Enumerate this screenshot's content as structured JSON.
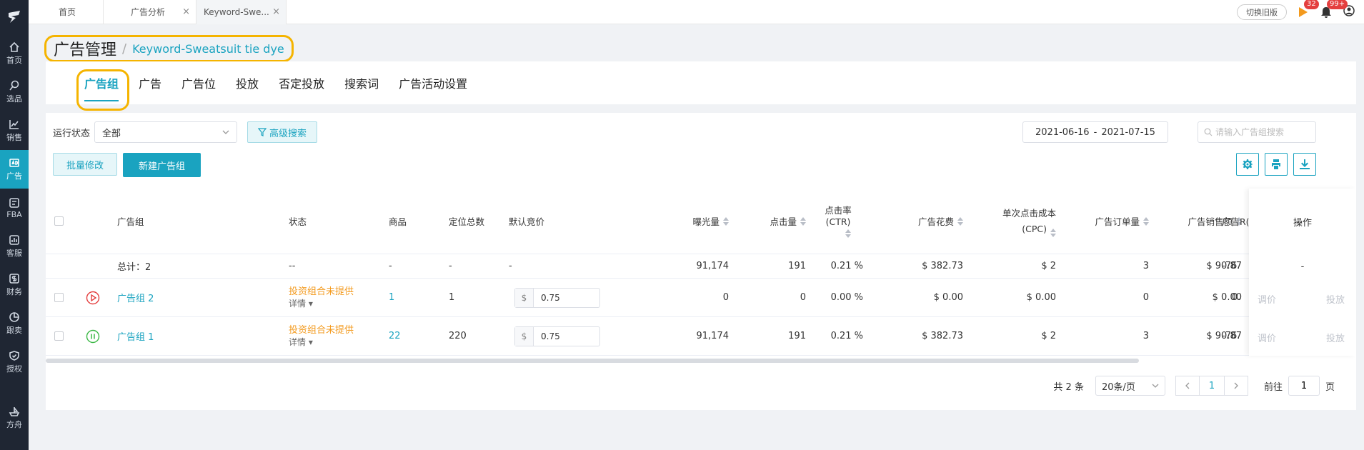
{
  "sidebar": {
    "items": [
      {
        "label": "首页",
        "icon": "home-icon"
      },
      {
        "label": "选品",
        "icon": "search-icon"
      },
      {
        "label": "销售",
        "icon": "chart-line-icon"
      },
      {
        "label": "广告",
        "icon": "ad-icon",
        "active": true
      },
      {
        "label": "FBA",
        "icon": "fba-icon"
      },
      {
        "label": "客服",
        "icon": "service-icon"
      },
      {
        "label": "财务",
        "icon": "finance-icon"
      },
      {
        "label": "跟卖",
        "icon": "pie-icon"
      },
      {
        "label": "授权",
        "icon": "shield-icon"
      }
    ],
    "bottom": {
      "label": "方舟",
      "icon": "ark-icon"
    }
  },
  "topbar": {
    "tabs": [
      "首页",
      "广告分析",
      "Keyword-Swe..."
    ],
    "switch_label": "切换旧版",
    "flag_badge": "32",
    "bell_badge": "99+"
  },
  "breadcrumb": {
    "main": "广告管理",
    "sep": "/",
    "sub": "Keyword-Sweatsuit tie dye"
  },
  "subtabs": [
    "广告组",
    "广告",
    "广告位",
    "投放",
    "否定投放",
    "搜索词",
    "广告活动设置"
  ],
  "filters": {
    "status_label": "运行状态",
    "status_value": "全部",
    "advanced_label": "高级搜索",
    "date_start": "2021-06-16",
    "date_sep": "-",
    "date_end": "2021-07-15",
    "search_placeholder": "请输入广告组搜索"
  },
  "buttons": {
    "batch_edit": "批量修改",
    "new_group": "新建广告组"
  },
  "table": {
    "headers": {
      "group": "广告组",
      "status": "状态",
      "product": "商品",
      "targets": "定位总数",
      "bid": "默认竞价",
      "impressions": "曝光量",
      "clicks": "点击量",
      "ctr_1": "点击率",
      "ctr_2": "(CTR)",
      "spend": "广告花费",
      "cpc_1": "单次点击成本",
      "cpc_2": "(CPC)",
      "orders": "广告订单量",
      "sales": "广告销售额",
      "acos": "广告R(",
      "ops": "操作"
    },
    "total": {
      "label": "总计：2",
      "status": "--",
      "product": "-",
      "targets": "-",
      "bid": "-",
      "impressions": "91,174",
      "clicks": "191",
      "ctr": "0.21 %",
      "spend": "$ 382.73",
      "cpc": "$ 2",
      "orders": "3",
      "sales": "$ 90.87",
      "acos": "-76.",
      "ops": "-"
    },
    "rows": [
      {
        "name": "广告组 2",
        "state_icon": "play-circle-icon",
        "status": "投资组合未提供",
        "detail": "详情",
        "product": "1",
        "targets": "1",
        "currency": "$",
        "bid": "0.75",
        "impressions": "0",
        "clicks": "0",
        "ctr": "0.00 %",
        "spend": "$ 0.00",
        "cpc": "$ 0.00",
        "orders": "0",
        "sales": "$ 0.00",
        "acos": "0.",
        "op1": "调价",
        "op2": "投放"
      },
      {
        "name": "广告组 1",
        "state_icon": "pause-circle-icon",
        "status": "投资组合未提供",
        "detail": "详情",
        "product": "22",
        "targets": "220",
        "currency": "$",
        "bid": "0.75",
        "impressions": "91,174",
        "clicks": "191",
        "ctr": "0.21 %",
        "spend": "$ 382.73",
        "cpc": "$ 2",
        "orders": "3",
        "sales": "$ 90.87",
        "acos": "-76.",
        "op1": "调价",
        "op2": "投放"
      }
    ]
  },
  "pager": {
    "total": "共 2 条",
    "size": "20条/页",
    "current": "1",
    "goto_label": "前往",
    "goto_value": "1",
    "page_suffix": "页"
  },
  "colors": {
    "accent": "#1aa3c0",
    "sidebar": "#1f2633",
    "highlight": "#f5b400",
    "warning": "#f39a1e"
  }
}
